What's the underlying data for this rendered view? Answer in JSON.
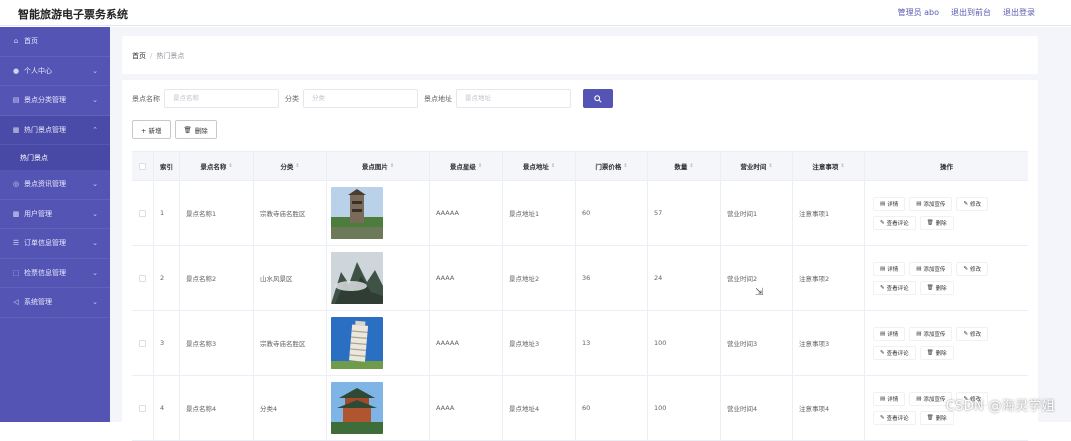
{
  "app": {
    "title": "智能旅游电子票务系统",
    "user": "管理员 abo",
    "links": [
      "退出到前台",
      "退出登录"
    ]
  },
  "sidebar": {
    "items": [
      {
        "label": "首页",
        "icon": "home-icon",
        "expandable": false
      },
      {
        "label": "个人中心",
        "icon": "user-icon",
        "expandable": true
      },
      {
        "label": "景点分类管理",
        "icon": "list-icon",
        "expandable": true
      },
      {
        "label": "热门景点管理",
        "icon": "grid-icon",
        "expandable": true,
        "expanded": true
      },
      {
        "label": "景点资讯管理",
        "icon": "info-icon",
        "expandable": true
      },
      {
        "label": "用户管理",
        "icon": "users-icon",
        "expandable": true
      },
      {
        "label": "订单信息管理",
        "icon": "order-icon",
        "expandable": true
      },
      {
        "label": "检票信息管理",
        "icon": "ticket-icon",
        "expandable": true
      },
      {
        "label": "系统管理",
        "icon": "send-icon",
        "expandable": true
      }
    ],
    "sub_item": "热门景点"
  },
  "breadcrumb": {
    "home": "首页",
    "separator": "/",
    "current": "热门景点"
  },
  "search": {
    "fields": [
      {
        "label": "景点名称",
        "placeholder": "景点名称"
      },
      {
        "label": "分类",
        "placeholder": "分类"
      },
      {
        "label": "景点地址",
        "placeholder": "景点地址"
      }
    ]
  },
  "actions": {
    "add": "+ 新增",
    "delete": "删除"
  },
  "table": {
    "headers": [
      "索引",
      "景点名称",
      "分类",
      "景点图片",
      "景点星级",
      "景点地址",
      "门票价格",
      "数量",
      "营业时间",
      "注意事项",
      "操作"
    ],
    "sortable": [
      false,
      true,
      true,
      true,
      true,
      true,
      true,
      true,
      true,
      true,
      false
    ],
    "rows": [
      {
        "index": "1",
        "name": "景点名称1",
        "category": "宗教寺庙名胜区",
        "stars": "AAAAA",
        "address": "景点地址1",
        "price": "60",
        "qty": "57",
        "hours": "营业时间1",
        "notes": "注意事项1",
        "image": "tower-photo"
      },
      {
        "index": "2",
        "name": "景点名称2",
        "category": "山水风景区",
        "stars": "AAAA",
        "address": "景点地址2",
        "price": "36",
        "qty": "24",
        "hours": "营业时间2",
        "notes": "注意事项2",
        "image": "mountain-photo"
      },
      {
        "index": "3",
        "name": "景点名称3",
        "category": "宗教寺庙名胜区",
        "stars": "AAAAA",
        "address": "景点地址3",
        "price": "13",
        "qty": "100",
        "hours": "营业时间3",
        "notes": "注意事项3",
        "image": "leaning-tower-photo"
      },
      {
        "index": "4",
        "name": "景点名称4",
        "category": "分类4",
        "stars": "AAAA",
        "address": "景点地址4",
        "price": "60",
        "qty": "100",
        "hours": "营业时间4",
        "notes": "注意事项4",
        "image": "pavilion-photo"
      }
    ],
    "ops": [
      "详情",
      "添加宣传",
      "修改",
      "查看评论",
      "删除"
    ]
  },
  "watermark": "CSDN @海灵学姐",
  "colors": {
    "accent": "#5454b5",
    "sidebar_bg": "#5454b5"
  }
}
